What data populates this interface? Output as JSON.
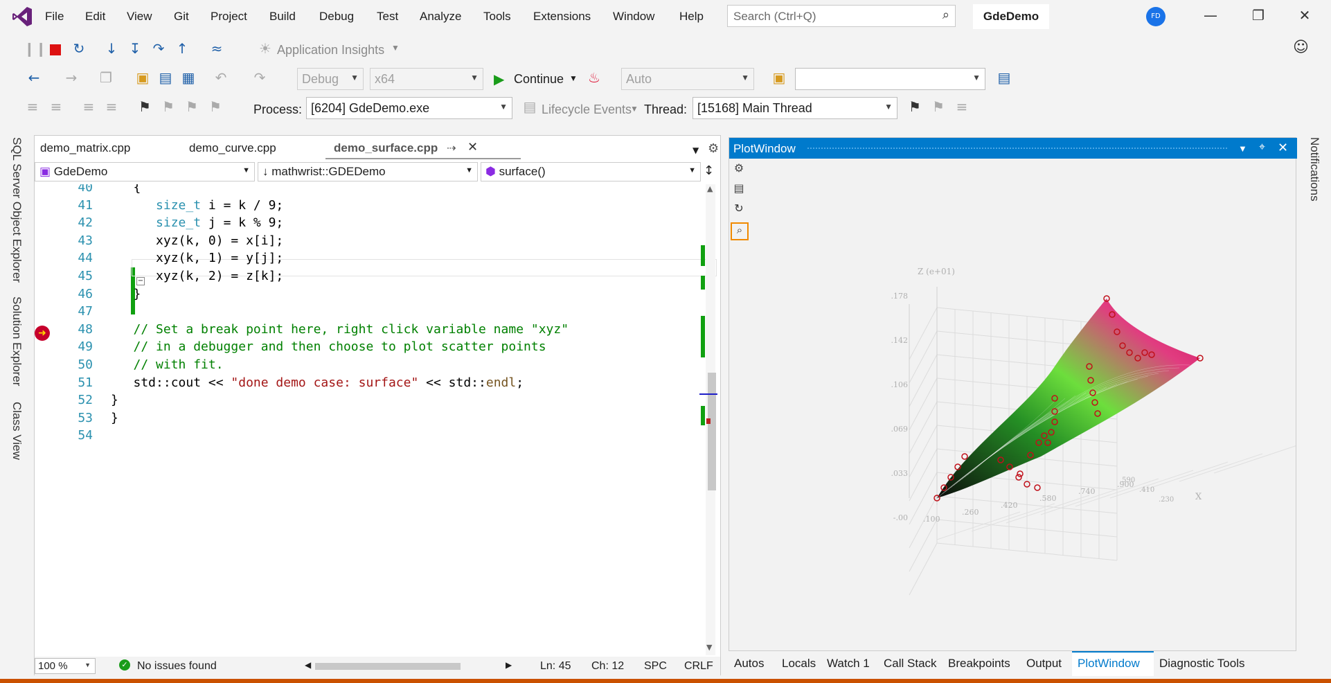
{
  "menu": [
    "File",
    "Edit",
    "View",
    "Git",
    "Project",
    "Build",
    "Debug",
    "Test",
    "Analyze",
    "Tools",
    "Extensions",
    "Window",
    "Help"
  ],
  "search": {
    "placeholder": "Search (Ctrl+Q)"
  },
  "solution_name": "GdeDemo",
  "avatar": "FD",
  "toolbar1": {
    "app_insights": "Application Insights"
  },
  "toolbar2": {
    "config": "Debug",
    "platform": "x64",
    "continue": "Continue",
    "auto": "Auto"
  },
  "toolbar3": {
    "process_label": "Process:",
    "process": "[6204] GdeDemo.exe",
    "lifecycle": "Lifecycle Events",
    "thread_label": "Thread:",
    "thread": "[15168] Main Thread"
  },
  "side_tabs": [
    "SQL Server Object Explorer",
    "Solution Explorer",
    "Class View"
  ],
  "right_side_tab": "Notifications",
  "doc_tabs": [
    "demo_matrix.cpp",
    "demo_curve.cpp",
    "demo_surface.cpp"
  ],
  "nav": {
    "project": "GdeDemo",
    "scope": "mathwrist::GDEDemo",
    "member": "surface()"
  },
  "code_lines": [
    {
      "n": "40",
      "t": "   {"
    },
    {
      "n": "41",
      "t": "      size_t i = k / 9;"
    },
    {
      "n": "42",
      "t": "      size_t j = k % 9;"
    },
    {
      "n": "43",
      "t": "      xyz(k, 0) = x[i];"
    },
    {
      "n": "44",
      "t": "      xyz(k, 1) = y[j];"
    },
    {
      "n": "45",
      "t": "      xyz(k, 2) = z[k];"
    },
    {
      "n": "46",
      "t": "   }"
    },
    {
      "n": "47",
      "t": ""
    },
    {
      "n": "48",
      "t": "   // Set a break point here, right click variable name \"xyz\""
    },
    {
      "n": "49",
      "t": "   // in a debugger and then choose to plot scatter points"
    },
    {
      "n": "50",
      "t": "   // with fit."
    },
    {
      "n": "51",
      "t": "   std::cout << \"done demo case: surface\" << std::endl;"
    },
    {
      "n": "52",
      "t": "}"
    },
    {
      "n": "53",
      "t": "}"
    },
    {
      "n": "54",
      "t": ""
    }
  ],
  "editor_status": {
    "zoom": "100 %",
    "issues": "No issues found",
    "ln": "Ln: 45",
    "ch": "Ch: 12",
    "spc": "SPC",
    "crlf": "CRLF"
  },
  "plot_window": {
    "title": "PlotWindow",
    "zlabel": "Z (e+01)",
    "xlabel": "X",
    "zticks": [
      ".178",
      ".142",
      ".106",
      ".069",
      ".033",
      "-.00"
    ],
    "xticks": [
      ".100",
      ".260",
      ".420",
      ".580",
      ".740",
      ".900"
    ],
    "yticks": [
      ".230",
      ".410",
      ".590"
    ]
  },
  "bottom_tabs": [
    "Autos",
    "Locals",
    "Watch 1",
    "Call Stack",
    "Breakpoints",
    "Output",
    "PlotWindow",
    "Diagnostic Tools"
  ],
  "colors": {
    "accent": "#007acc",
    "status_orange": "#ca5100",
    "comment": "#008000",
    "string": "#a31515",
    "type": "#2b91af"
  }
}
